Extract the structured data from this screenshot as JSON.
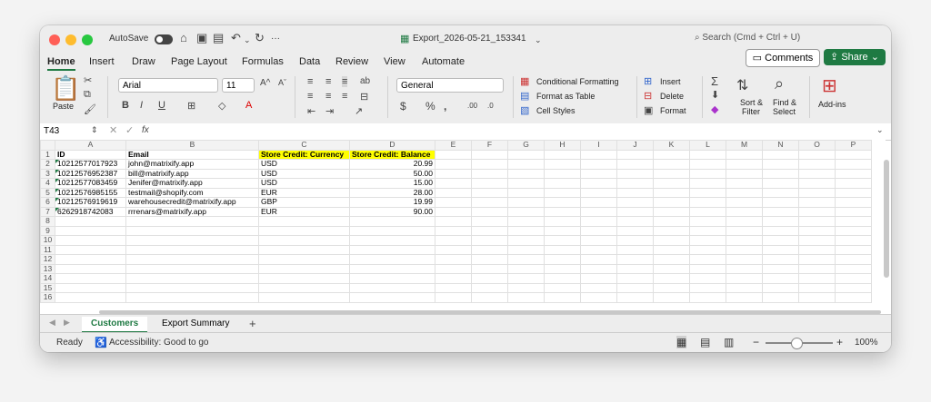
{
  "titlebar": {
    "autosave_label": "AutoSave",
    "file_name": "Export_2026-05-21_153341",
    "search_placeholder": "Search (Cmd + Ctrl + U)",
    "more": "···"
  },
  "tabs": [
    "Home",
    "Insert",
    "Draw",
    "Page Layout",
    "Formulas",
    "Data",
    "Review",
    "View",
    "Automate"
  ],
  "buttons": {
    "comments": "Comments",
    "share": "Share"
  },
  "ribbon": {
    "paste": "Paste",
    "font_name": "Arial",
    "font_size": "11",
    "number_format": "General",
    "conditional_formatting": "Conditional Formatting",
    "format_as_table": "Format as Table",
    "cell_styles": "Cell Styles",
    "insert": "Insert",
    "delete": "Delete",
    "format": "Format",
    "sort_filter_1": "Sort &",
    "sort_filter_2": "Filter",
    "find_select_1": "Find &",
    "find_select_2": "Select",
    "add_ins": "Add-ins"
  },
  "formula_bar": {
    "cell_ref": "T43",
    "fx": "fx",
    "value": ""
  },
  "sheet": {
    "columns": [
      "A",
      "B",
      "C",
      "D",
      "E",
      "F",
      "G",
      "H",
      "I",
      "J",
      "K",
      "L",
      "M",
      "N",
      "O",
      "P"
    ],
    "header_row": [
      "ID",
      "Email",
      "Store Credit: Currency",
      "Store Credit: Balance"
    ],
    "rows": [
      [
        "10212577017923",
        "john@matrixify.app",
        "USD",
        "20.99"
      ],
      [
        "10212576952387",
        "bill@matrixify.app",
        "USD",
        "50.00"
      ],
      [
        "10212577083459",
        "Jenifer@matrixify.app",
        "USD",
        "15.00"
      ],
      [
        "10212576985155",
        "testmail@shopify.com",
        "EUR",
        "28.00"
      ],
      [
        "10212576919619",
        "warehousecredit@matrixify.app",
        "GBP",
        "19.99"
      ],
      [
        "6262918742083",
        "rrrenars@matrixify.app",
        "EUR",
        "90.00"
      ]
    ],
    "row_numbers": [
      "1",
      "2",
      "3",
      "4",
      "5",
      "6",
      "7",
      "8",
      "9",
      "10",
      "11",
      "12",
      "13",
      "14",
      "15",
      "16"
    ]
  },
  "sheet_tabs": [
    "Customers",
    "Export Summary"
  ],
  "status": {
    "ready": "Ready",
    "accessibility": "Accessibility: Good to go",
    "zoom": "100%"
  },
  "colors": {
    "accent": "#1f7a43",
    "highlight": "#ffff00"
  }
}
